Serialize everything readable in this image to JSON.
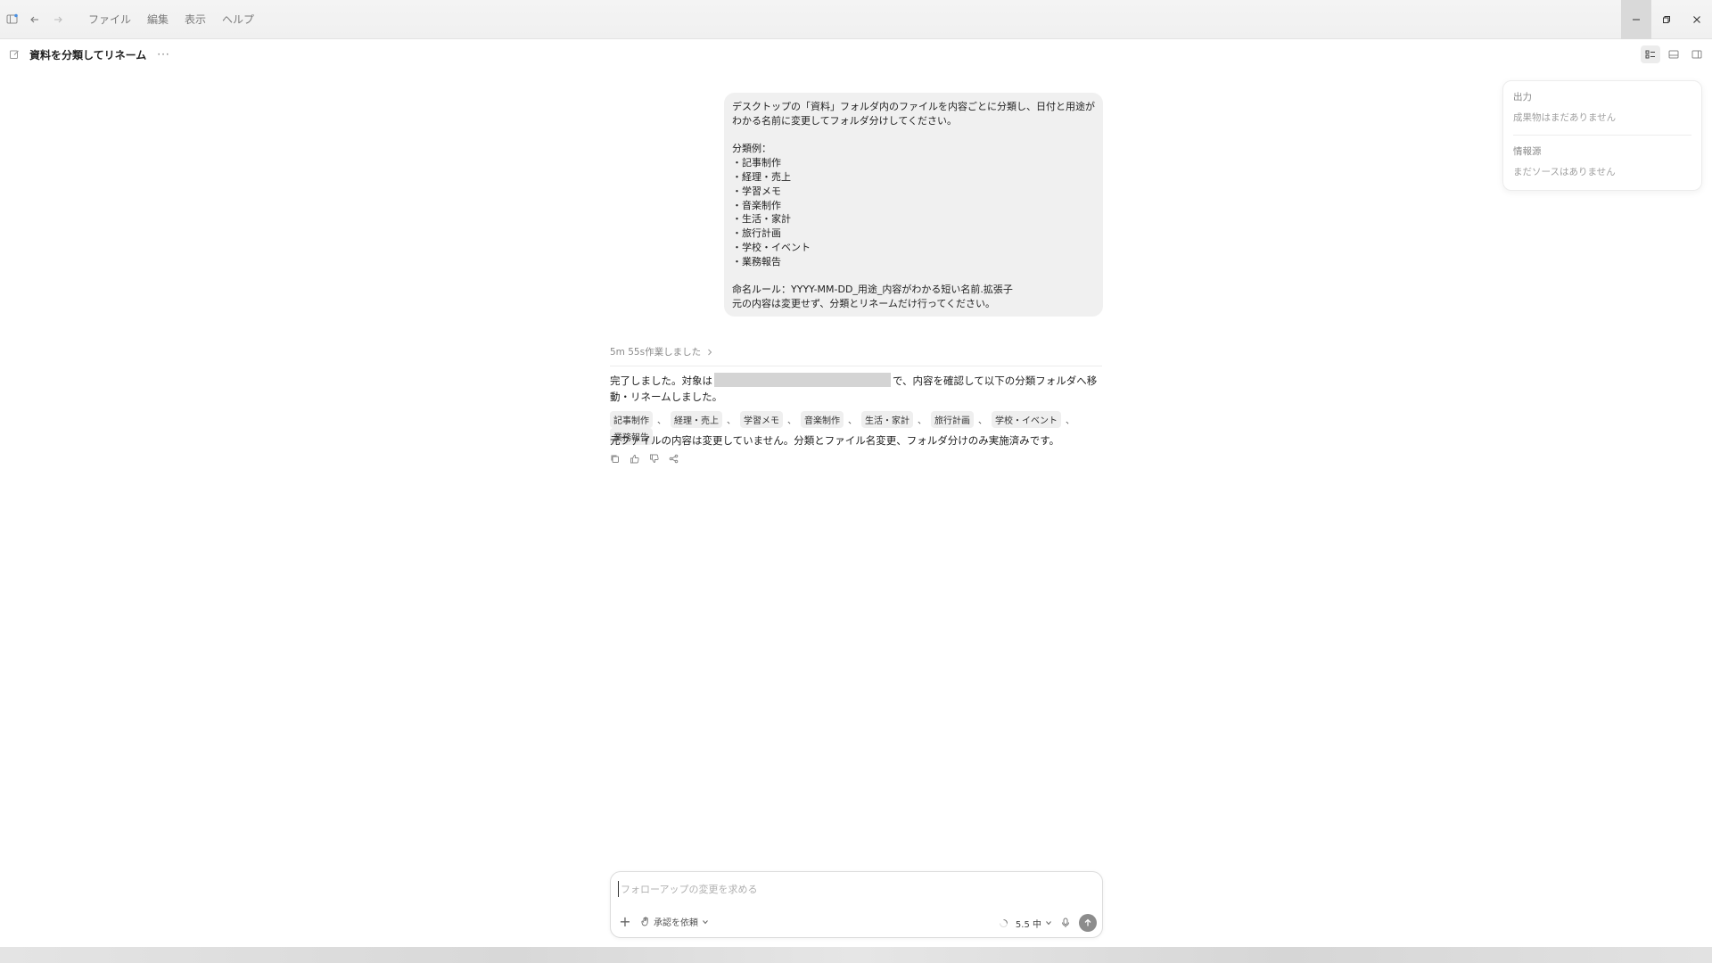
{
  "menu": {
    "items": [
      "ファイル",
      "編集",
      "表示",
      "ヘルプ"
    ]
  },
  "header": {
    "title": "資料を分類してリネーム",
    "more": "···"
  },
  "user_message": {
    "text": "デスクトップの「資料」フォルダ内のファイルを内容ごとに分類し、日付と用途がわかる名前に変更してフォルダ分けしてください。\n\n分類例：\n・記事制作\n・経理・売上\n・学習メモ\n・音楽制作\n・生活・家計\n・旅行計画\n・学校・イベント\n・業務報告\n\n命名ルール：YYYY-MM-DD_用途_内容がわかる短い名前.拡張子\n元の内容は変更せず、分類とリネームだけ行ってください。"
  },
  "assistant": {
    "work_summary": "5m 55s作業しました",
    "text_before": "完了しました。対象は",
    "text_after": "で、内容を確認して以下の分類フォルダへ移動・リネームしました。",
    "tags": [
      "記事制作",
      "経理・売上",
      "学習メモ",
      "音楽制作",
      "生活・家計",
      "旅行計画",
      "学校・イベント",
      "業務報告"
    ],
    "tag_separator": "、",
    "closing": "元ファイルの内容は変更していません。分類とファイル名変更、フォルダ分けのみ実施済みです。"
  },
  "side_panel": {
    "output_title": "出力",
    "output_empty": "成果物はまだありません",
    "sources_title": "情報源",
    "sources_empty": "まだソースはありません"
  },
  "composer": {
    "placeholder": "フォローアップの変更を求める",
    "approval_label": "承認を依頼",
    "model_label": "5.5 中"
  }
}
